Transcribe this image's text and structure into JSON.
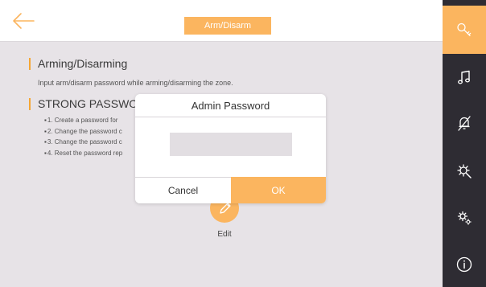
{
  "header": {
    "title": "Arm/Disarm"
  },
  "content": {
    "section1": {
      "heading": "Arming/Disarming",
      "description": "Input arm/disarm password while arming/disarming the zone."
    },
    "section2": {
      "heading": "STRONG PASSWORD",
      "bullets": [
        "1. Create a password for",
        "2. Change the password c",
        "3. Change the password c",
        "4. Reset the password rep"
      ]
    },
    "edit": {
      "label": "Edit"
    }
  },
  "dialog": {
    "title": "Admin Password",
    "password_value": "",
    "cancel_label": "Cancel",
    "ok_label": "OK"
  },
  "sidebar": {
    "items": [
      {
        "icon": "key-icon",
        "active": true
      },
      {
        "icon": "music-note-icon",
        "active": false
      },
      {
        "icon": "alarm-bell-off-icon",
        "active": false
      },
      {
        "icon": "settings-search-icon",
        "active": false
      },
      {
        "icon": "gears-icon",
        "active": false
      },
      {
        "icon": "info-icon",
        "active": false
      }
    ]
  },
  "colors": {
    "accent": "#fbb55f",
    "sidebar_bg": "#2e2c33",
    "content_bg": "#e7e3e7"
  }
}
